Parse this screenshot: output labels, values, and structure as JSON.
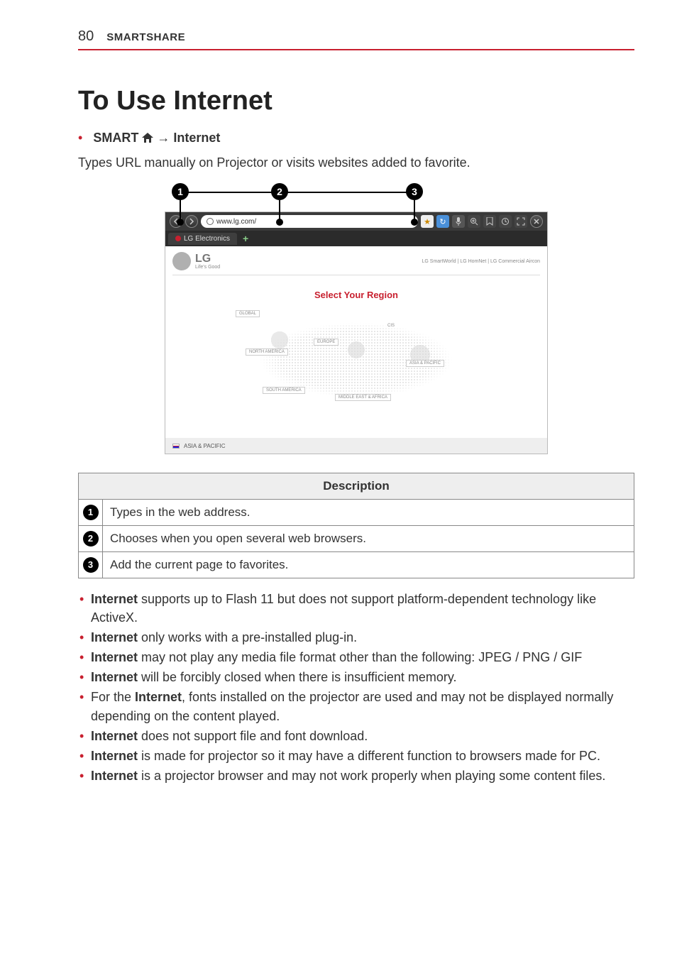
{
  "page_number": "80",
  "section": "SMARTSHARE",
  "title": "To Use Internet",
  "nav": {
    "prefix": "SMART",
    "arrow": "→",
    "target": "Internet"
  },
  "intro": "Types URL manually on Projector or visits websites added to favorite.",
  "callouts": {
    "c1": "1",
    "c2": "2",
    "c3": "3"
  },
  "browser": {
    "url": "www.lg.com/",
    "tab_label": "LG Electronics",
    "top_links": "LG SmartWorld | LG HomNet | LG Commercial Aircon",
    "logo_text": "LG",
    "logo_sub": "Life's Good",
    "region_title": "Select Your Region",
    "labels": {
      "global": "GLOBAL",
      "na": "NORTH AMERICA",
      "sa": "SOUTH AMERICA",
      "eu": "EUROPE",
      "me": "MIDDLE EAST & AFRICA",
      "ap": "ASIA & PACIFIC",
      "cis": "CIS"
    },
    "footer_region": "ASIA & PACIFIC"
  },
  "table": {
    "header": "Description",
    "rows": [
      {
        "n": "1",
        "text": "Types in the web address."
      },
      {
        "n": "2",
        "text": "Chooses when you open several web browsers."
      },
      {
        "n": "3",
        "text": "Add the current page to favorites."
      }
    ]
  },
  "notes": [
    {
      "bold": "Internet",
      "rest": " supports up to Flash 11 but does not support platform-dependent technology like ActiveX."
    },
    {
      "bold": "Internet",
      "rest": " only works with a pre-installed plug-in."
    },
    {
      "bold": "Internet",
      "rest": " may not play any media file format other than the following: JPEG / PNG / GIF"
    },
    {
      "bold": "Internet",
      "rest": " will be forcibly closed when there is insufficient memory."
    },
    {
      "prefix": "For the ",
      "bold": "Internet",
      "rest": ", fonts installed on the projector are used and may not be displayed normally depending on the content played."
    },
    {
      "bold": "Internet",
      "rest": " does not support file and font download."
    },
    {
      "bold": "Internet",
      "rest": " is made for projector so it may have a different function to browsers made for PC."
    },
    {
      "bold": "Internet",
      "rest": " is a projector browser and may not work properly when playing some content files."
    }
  ]
}
